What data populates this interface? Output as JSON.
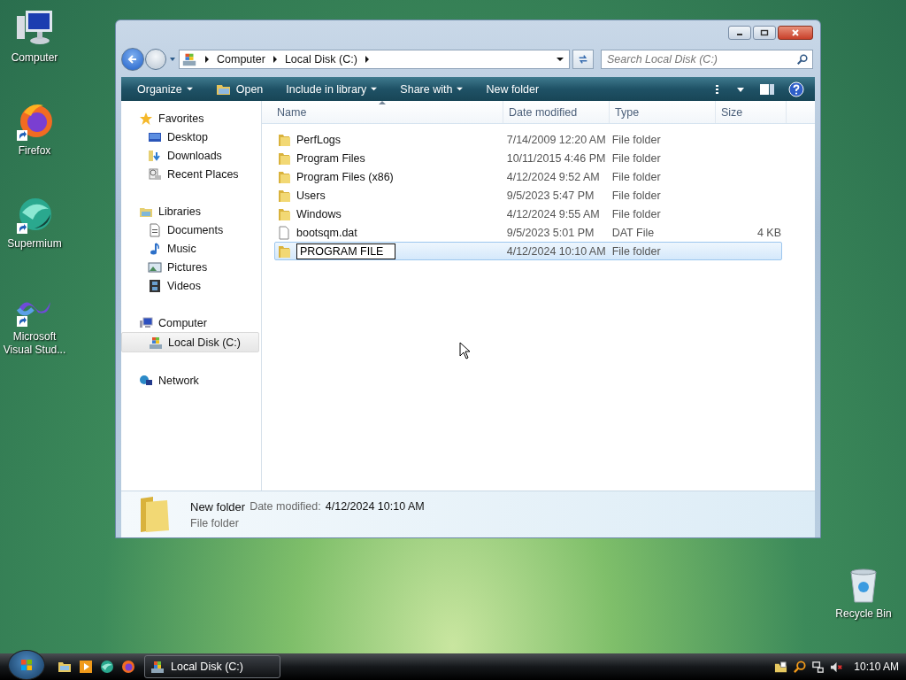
{
  "desktop_icons": [
    {
      "label": "Computer",
      "kind": "computer",
      "shortcut": false
    },
    {
      "label": "Firefox",
      "kind": "firefox",
      "shortcut": true
    },
    {
      "label": "Supermium",
      "kind": "supermium",
      "shortcut": true
    },
    {
      "label": "Microsoft Visual Stud...",
      "kind": "vs",
      "shortcut": true
    }
  ],
  "recycle_bin": {
    "label": "Recycle Bin"
  },
  "window": {
    "address": [
      "Computer",
      "Local Disk (C:)"
    ],
    "search": {
      "placeholder": "Search Local Disk (C:)"
    },
    "toolbar": [
      {
        "label": "Organize",
        "dropdown": true,
        "kind": "plain"
      },
      {
        "label": "Open",
        "dropdown": false,
        "kind": "open"
      },
      {
        "label": "Include in library",
        "dropdown": true,
        "kind": "plain"
      },
      {
        "label": "Share with",
        "dropdown": true,
        "kind": "plain"
      },
      {
        "label": "New folder",
        "dropdown": false,
        "kind": "plain"
      }
    ],
    "nav": [
      {
        "label": "Favorites",
        "kind": "star",
        "selected": false,
        "children": [
          {
            "label": "Desktop",
            "kind": "desktop",
            "selected": false
          },
          {
            "label": "Downloads",
            "kind": "downloads",
            "selected": false
          },
          {
            "label": "Recent Places",
            "kind": "recent",
            "selected": false
          }
        ]
      },
      {
        "label": "Libraries",
        "kind": "library",
        "selected": false,
        "children": [
          {
            "label": "Documents",
            "kind": "documents",
            "selected": false
          },
          {
            "label": "Music",
            "kind": "music",
            "selected": false
          },
          {
            "label": "Pictures",
            "kind": "pictures",
            "selected": false
          },
          {
            "label": "Videos",
            "kind": "videos",
            "selected": false
          }
        ]
      },
      {
        "label": "Computer",
        "kind": "computer",
        "selected": false,
        "children": [
          {
            "label": "Local Disk (C:)",
            "kind": "disk",
            "selected": true
          }
        ]
      },
      {
        "label": "Network",
        "kind": "network",
        "selected": false
      }
    ],
    "columns": [
      {
        "label": "Name",
        "sorted": true
      },
      {
        "label": "Date modified",
        "sorted": false
      },
      {
        "label": "Type",
        "sorted": false
      },
      {
        "label": "Size",
        "sorted": false
      }
    ],
    "rows": [
      {
        "name": "PerfLogs",
        "date": "7/14/2009 12:20 AM",
        "type": "File folder",
        "kind": "folder",
        "selected": false,
        "editing": false
      },
      {
        "name": "Program Files",
        "date": "10/11/2015 4:46 PM",
        "type": "File folder",
        "kind": "folder",
        "selected": false,
        "editing": false
      },
      {
        "name": "Program Files (x86)",
        "date": "4/12/2024 9:52 AM",
        "type": "File folder",
        "kind": "folder",
        "selected": false,
        "editing": false
      },
      {
        "name": "Users",
        "date": "9/5/2023 5:47 PM",
        "type": "File folder",
        "kind": "folder",
        "selected": false,
        "editing": false
      },
      {
        "name": "Windows",
        "date": "4/12/2024 9:55 AM",
        "type": "File folder",
        "kind": "folder",
        "selected": false,
        "editing": false
      },
      {
        "name": "bootsqm.dat",
        "date": "9/5/2023 5:01 PM",
        "type": "DAT File",
        "size": "4 KB",
        "kind": "file",
        "selected": false,
        "editing": false
      },
      {
        "name": "PROGRAM FILE",
        "date": "4/12/2024 10:10 AM",
        "type": "File folder",
        "kind": "folder",
        "selected": true,
        "editing": true
      }
    ],
    "details": {
      "name": "New folder",
      "date_label": "Date modified:",
      "date": "4/12/2024 10:10 AM",
      "type": "File folder"
    }
  },
  "taskbar": {
    "tasks": [
      {
        "label": "Local Disk (C:)",
        "selected": true
      }
    ],
    "clock": "10:10 AM"
  }
}
